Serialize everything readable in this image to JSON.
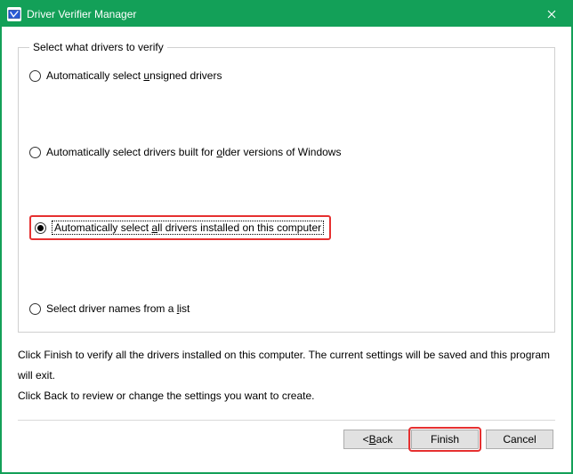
{
  "window": {
    "title": "Driver Verifier Manager"
  },
  "group": {
    "legend": "Select what drivers to verify"
  },
  "options": {
    "unsigned": {
      "pre": "Automatically select ",
      "ul": "u",
      "post": "nsigned drivers"
    },
    "older": {
      "pre": "Automatically select drivers built for ",
      "ul": "o",
      "post": "lder versions of Windows"
    },
    "all": {
      "pre": "Automatically select ",
      "ul": "a",
      "post": "ll drivers installed on this computer"
    },
    "list": {
      "pre": "Select driver names from a ",
      "ul": "l",
      "post": "ist"
    }
  },
  "info": {
    "line1": "Click Finish to verify all the drivers installed on this computer. The current settings will be saved and this program will exit.",
    "line2": "Click Back to review or change the settings you want to create."
  },
  "buttons": {
    "back": {
      "pre": "< ",
      "ul": "B",
      "post": "ack"
    },
    "finish": {
      "label": "Finish"
    },
    "cancel": {
      "label": "Cancel"
    }
  },
  "colors": {
    "accent": "#13a058",
    "highlight": "#e63030"
  }
}
